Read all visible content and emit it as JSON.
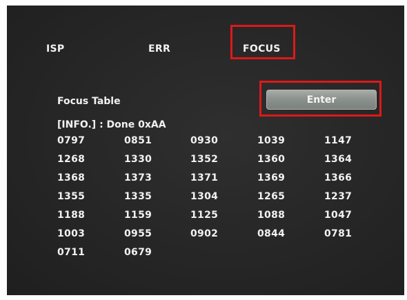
{
  "tabs": [
    {
      "label": "ISP"
    },
    {
      "label": "ERR"
    },
    {
      "label": "FOCUS"
    }
  ],
  "focus_table": {
    "title": "Focus Table",
    "enter_label": "Enter",
    "info": "[INFO.] : Done 0xAA",
    "rows": [
      [
        "0797",
        "0851",
        "0930",
        "1039",
        "1147"
      ],
      [
        "1268",
        "1330",
        "1352",
        "1360",
        "1364"
      ],
      [
        "1368",
        "1373",
        "1371",
        "1369",
        "1366"
      ],
      [
        "1355",
        "1335",
        "1304",
        "1265",
        "1237"
      ],
      [
        "1188",
        "1159",
        "1125",
        "1088",
        "1047"
      ],
      [
        "1003",
        "0955",
        "0902",
        "0844",
        "0781"
      ],
      [
        "0711",
        "0679",
        "",
        "",
        ""
      ]
    ]
  },
  "highlight_color": "#e01818"
}
